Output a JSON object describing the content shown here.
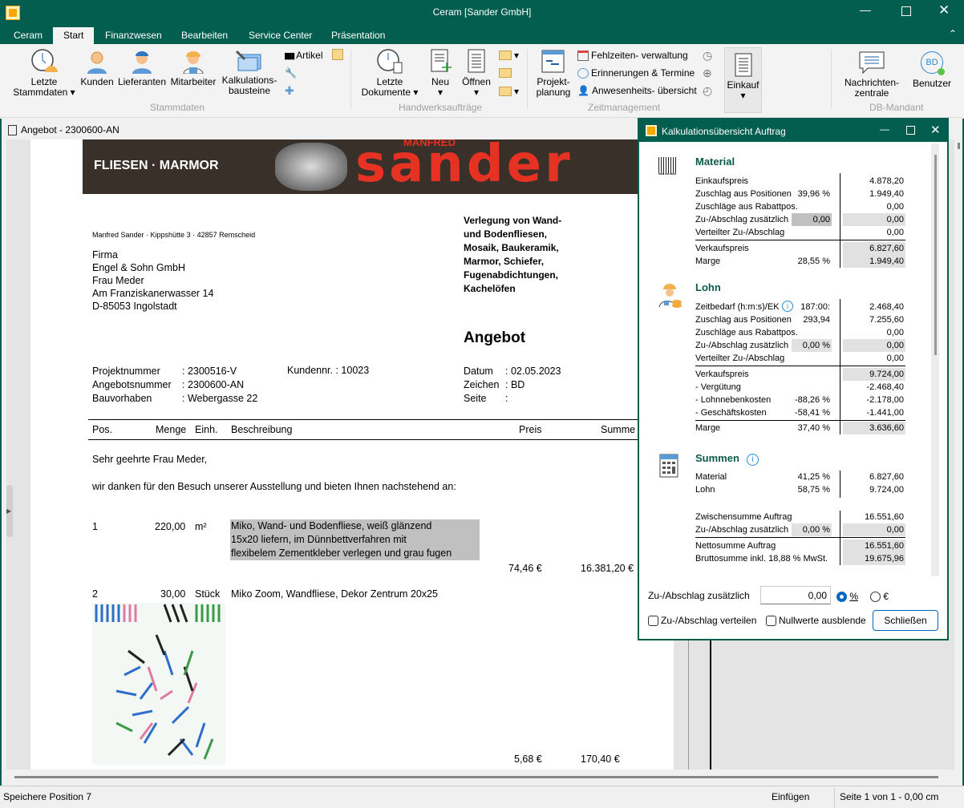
{
  "app": {
    "title": "Ceram [Sander GmbH]"
  },
  "tabs": [
    "Ceram",
    "Start",
    "Finanzwesen",
    "Bearbeiten",
    "Service Center",
    "Präsentation"
  ],
  "ribbon": {
    "stammdaten": {
      "label": "Stammdaten",
      "letzte": "Letzte",
      "stammdaten_btn": "Stammdaten ▾",
      "kunden": "Kunden",
      "lieferanten": "Lieferanten",
      "mitarbeiter": "Mitarbeiter",
      "kalk1": "Kalkulations-",
      "kalk2": "bausteine",
      "artikel": "Artikel"
    },
    "handwerk": {
      "label": "Handwerksaufträge",
      "letzte": "Letzte",
      "dokumente": "Dokumente ▾",
      "neu": "Neu",
      "oeffnen": "Öffnen"
    },
    "zeit": {
      "label": "Zeitmanagement",
      "projekt1": "Projekt-",
      "projekt2": "planung",
      "fehlzeiten": "Fehlzeiten- verwaltung",
      "erinnerungen": "Erinnerungen & Termine",
      "anwesenheit": "Anwesenheits- übersicht"
    },
    "einkauf": "Einkauf",
    "db": {
      "label": "DB-Mandant",
      "nachrichten1": "Nachrichten-",
      "nachrichten2": "zentrale",
      "benutzer": "Benutzer",
      "avatar": "BD"
    }
  },
  "document": {
    "window_title": "Angebot - 2300600-AN",
    "logo": {
      "left": "FLIESEN · MARMOR",
      "brand": "sander",
      "brand_top": "MANFRED"
    },
    "sender": "Manfred Sander · Kippshütte 3 · 42857 Remscheid",
    "address": [
      "Firma",
      "Engel & Sohn GmbH",
      "Frau Meder",
      "Am Franziskanerwasser 14",
      "D-85053 Ingolstadt"
    ],
    "tagline": [
      "Verlegung von Wand-",
      "und Bodenfliesen,",
      "Mosaik, Baukeramik,",
      "Marmor, Schiefer,",
      "Fugenabdichtungen,",
      "Kachelöfen"
    ],
    "heading": "Angebot",
    "meta_left": [
      {
        "k": "Projektnummer",
        "v": ": 2300516-V"
      },
      {
        "k": "Angebotsnummer",
        "v": ": 2300600-AN"
      },
      {
        "k": "Bauvorhaben",
        "v": ": Webergasse 22"
      }
    ],
    "kundennr": "Kundennr. : 10023",
    "meta_right": [
      {
        "k": "Datum",
        "v": ": 02.05.2023"
      },
      {
        "k": "Zeichen",
        "v": ": BD"
      },
      {
        "k": "Seite",
        "v": ":"
      }
    ],
    "columns": [
      "Pos.",
      "Menge",
      "Einh.",
      "Beschreibung",
      "Preis",
      "Summe"
    ],
    "greeting": "Sehr geehrte Frau Meder,",
    "intro": "wir danken für den Besuch unserer Ausstellung und bieten Ihnen nachstehend an:",
    "items": [
      {
        "pos": "1",
        "menge": "220,00",
        "einh": "m²",
        "desc": [
          "Miko, Wand- und Bodenfliese, weiß glänzend",
          "15x20 liefern, im Dünnbettverfahren mit",
          "flexibelem Zementkleber verlegen und grau fugen"
        ],
        "preis": "74,46 €",
        "summe": "16.381,20 €"
      },
      {
        "pos": "2",
        "menge": "30,00",
        "einh": "Stück",
        "desc": [
          "Miko Zoom, Wandfliese, Dekor Zentrum 20x25"
        ],
        "preis": "5,68 €",
        "summe": "170,40 €"
      }
    ]
  },
  "dialog": {
    "title": "Kalkulationsübersicht Auftrag",
    "material": {
      "title": "Material",
      "rows": [
        {
          "l": "Einkaufspreis",
          "p": "",
          "v": "4.878,20"
        },
        {
          "l": "Zuschlag aus Positionen",
          "p": "39,96 %",
          "v": "1.949,40"
        },
        {
          "l": "Zuschläge aus Rabattpos.",
          "p": "",
          "v": "0,00"
        },
        {
          "l": "Zu-/Abschlag zusätzlich",
          "p": "0,00",
          "v": "0,00"
        },
        {
          "l": "Verteilter Zu-/Abschlag",
          "p": "",
          "v": "0,00"
        },
        {
          "l": "Verkaufspreis",
          "p": "",
          "v": "6.827,60"
        },
        {
          "l": "Marge",
          "p": "28,55 %",
          "v": "1.949,40"
        }
      ]
    },
    "lohn": {
      "title": "Lohn",
      "rows": [
        {
          "l": "Zeitbedarf (h:m:s)/EK",
          "p": "187:00:",
          "v": "2.468,40"
        },
        {
          "l": "Zuschlag aus Positionen",
          "p": "293,94",
          "v": "7.255,60"
        },
        {
          "l": "Zuschläge aus Rabattpos.",
          "p": "",
          "v": "0,00"
        },
        {
          "l": "Zu-/Abschlag zusätzlich",
          "p": "0,00 %",
          "v": "0,00"
        },
        {
          "l": "Verteilter Zu-/Abschlag",
          "p": "",
          "v": "0,00"
        },
        {
          "l": "Verkaufspreis",
          "p": "",
          "v": "9.724,00"
        },
        {
          "l": " - Vergütung",
          "p": "",
          "v": "-2.468,40"
        },
        {
          "l": " - Lohnnebenkosten",
          "p": "-88,26 %",
          "v": "-2.178,00"
        },
        {
          "l": " - Geschäftskosten",
          "p": "-58,41 %",
          "v": "-1.441,00"
        },
        {
          "l": "Marge",
          "p": "37,40 %",
          "v": "3.636,60"
        }
      ]
    },
    "summen": {
      "title": "Summen",
      "rows": [
        {
          "l": "Material",
          "p": "41,25 %",
          "v": "6.827,60"
        },
        {
          "l": "Lohn",
          "p": "58,75 %",
          "v": "9.724,00"
        },
        {
          "l": "Zwischensumme Auftrag",
          "p": "",
          "v": "16.551,60"
        },
        {
          "l": "Zu-/Abschlag zusätzlich",
          "p": "0,00 %",
          "v": "0,00"
        },
        {
          "l": "Nettosumme Auftrag",
          "p": "",
          "v": "16.551,60"
        },
        {
          "l": "Bruttosumme inkl. 18,88 % MwSt.",
          "p": "",
          "v": "19.675,96"
        }
      ]
    },
    "adj_label": "Zu-/Abschlag zusätzlich",
    "adj_value": "0,00",
    "radio_pct": "%",
    "radio_eur": "€",
    "cb_verteilen": "Zu-/Abschlag verteilen",
    "cb_nullwerte": "Nullwerte ausblende",
    "close": "Schließen"
  },
  "status": {
    "left": "Speichere Position 7",
    "mode": "Einfügen",
    "page": "Seite 1 von 1 - 0,00 cm"
  },
  "colors": {
    "brand": "#035e4f",
    "accent": "#0067c0"
  }
}
